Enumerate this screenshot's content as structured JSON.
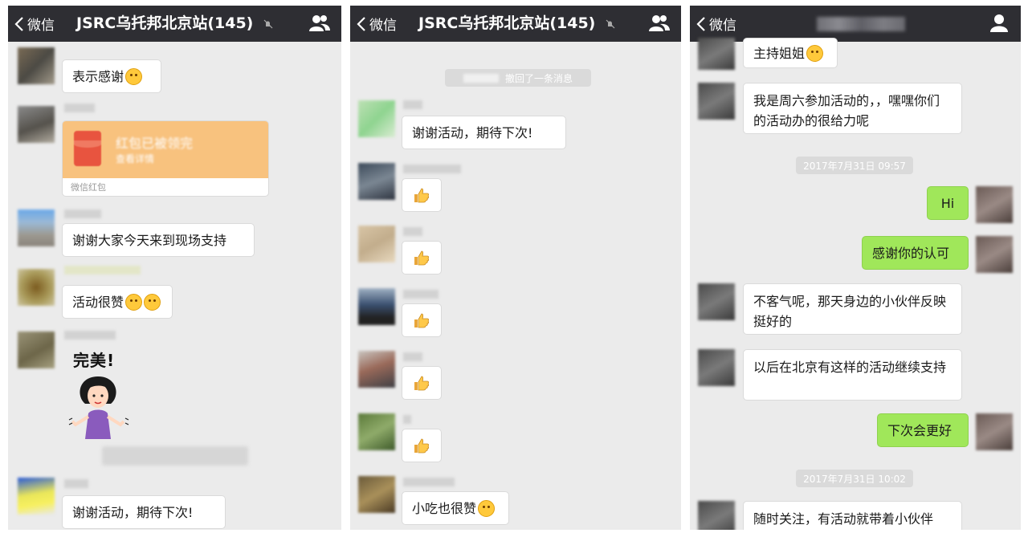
{
  "back_label": "微信",
  "panel1": {
    "title": "JSRC乌托邦北京站(145)",
    "messages": [
      "表示感谢",
      "谢谢大家今天来到现场支持",
      "活动很赞",
      "谢谢活动，期待下次!"
    ],
    "red_packet": {
      "title": "红包已被领完",
      "sub": "查看详情",
      "footer": "微信红包"
    },
    "sticker_text": "完美!"
  },
  "panel2": {
    "title": "JSRC乌托邦北京站(145)",
    "recall_notice": "撤回了一条消息",
    "messages": [
      "谢谢活动，期待下次!",
      "小吃也很赞"
    ]
  },
  "panel3": {
    "messages_left": [
      "主持姐姐",
      "我是周六参加活动的，，嘿嘿你们的活动办的很给力呢",
      "不客气呢，那天身边的小伙伴反映挺好的",
      "以后在北京有这样的活动继续支持",
      "随时关注，有活动就带着小伙伴"
    ],
    "messages_right": [
      "Hi",
      "感谢你的认可",
      "下次会更好"
    ],
    "timestamps": [
      "2017年7月31日 09:57",
      "2017年7月31日 10:02"
    ]
  },
  "colors": {
    "nav": "#2e2e33",
    "chat_bg": "#ebebeb",
    "green_bubble": "#a0e75a",
    "red_packet": "#f8c27e"
  },
  "icons": [
    "chevron-left-icon",
    "mute-icon",
    "group-icon",
    "person-icon",
    "thumbs-up-icon",
    "smile-emoji-icon",
    "laugh-emoji-icon"
  ]
}
